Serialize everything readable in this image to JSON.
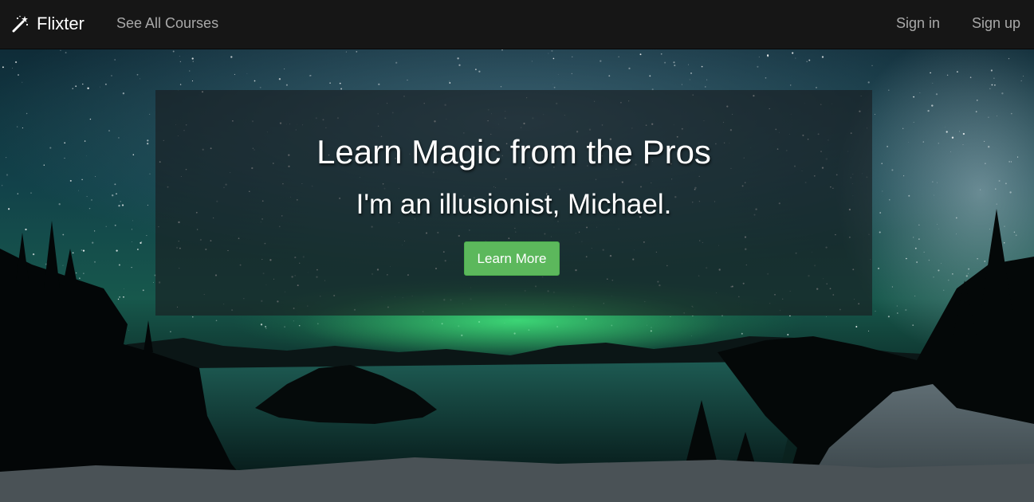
{
  "navbar": {
    "brand": "Flixter",
    "links": {
      "courses": "See All Courses",
      "sign_in": "Sign in",
      "sign_up": "Sign up"
    }
  },
  "hero": {
    "title": "Learn Magic from the Pros",
    "subtitle": "I'm an illusionist, Michael.",
    "cta_label": "Learn More"
  },
  "colors": {
    "navbar_bg": "#161616",
    "nav_link": "#a9a9a9",
    "cta_green": "#5cb85c"
  },
  "icons": {
    "brand": "magic-wand-icon"
  }
}
